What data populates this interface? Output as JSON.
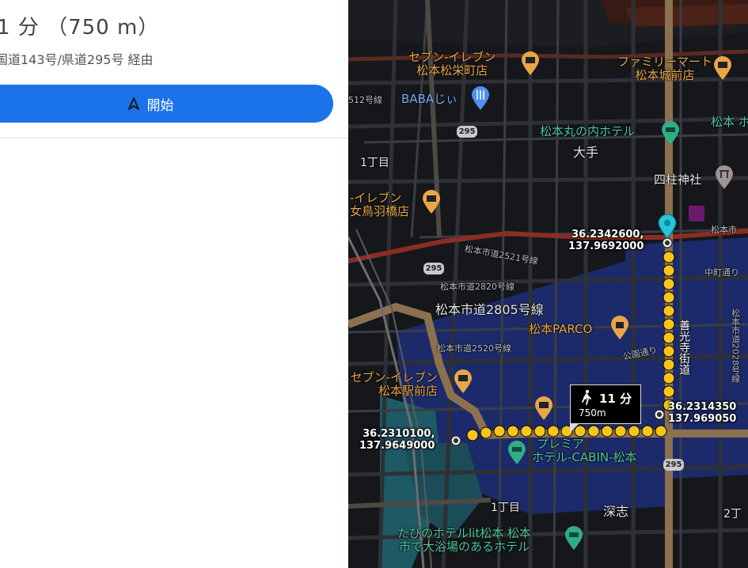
{
  "route": {
    "duration": "1 分 （750 m）",
    "via": "国道143号/県道295号 経由",
    "start_label": "開始"
  },
  "map": {
    "pois": {
      "seven_matsuei": [
        "セブン-イレブン",
        "松本松栄町店"
      ],
      "familymart": [
        "ファミリーマート",
        "松本城前店"
      ],
      "baba": "BABAじぃ",
      "maru_hotel": "松本丸の内ホテル",
      "yonahashira": "四柱神社",
      "seven_metoba": [
        "-イレブン",
        "女鳥羽橋店"
      ],
      "parco": "松本PARCO",
      "seven_station": [
        "セブン-イレブン",
        "松本駅前店"
      ],
      "premier": [
        "プレミア",
        "ホテル-CABIN-松本"
      ],
      "tabino": [
        "たびのホテルlit松本 松本",
        "市で大浴場のあるホテル"
      ],
      "maru_cut": "松本 ホ"
    },
    "places": {
      "ote": "大手",
      "itchome_top": "1丁目",
      "itchome_bottom": "1丁目",
      "fukashi": "深志",
      "nichome": "2丁"
    },
    "roads": {
      "r512": "512号線",
      "r2521": "松本市道2521号線",
      "r2820": "松本市道2820号線",
      "r2805": "松本市道2805号線",
      "r2520": "松本市道2520号線",
      "koen": "公園通り",
      "nakamachi": "中町通り",
      "r2028": "松本市道2028号線",
      "zenkoji": "善光寺街道",
      "matsumoto_shi": "松本市"
    },
    "shields": [
      "295",
      "295",
      "295"
    ],
    "coords": {
      "a": [
        "36.2342600,",
        "137.9692000"
      ],
      "b": [
        "36.2314350",
        "137.969050"
      ],
      "c": [
        "36.2310100,",
        "137.9649000"
      ]
    },
    "walk": {
      "time": "11 分",
      "distance": "750m"
    }
  }
}
